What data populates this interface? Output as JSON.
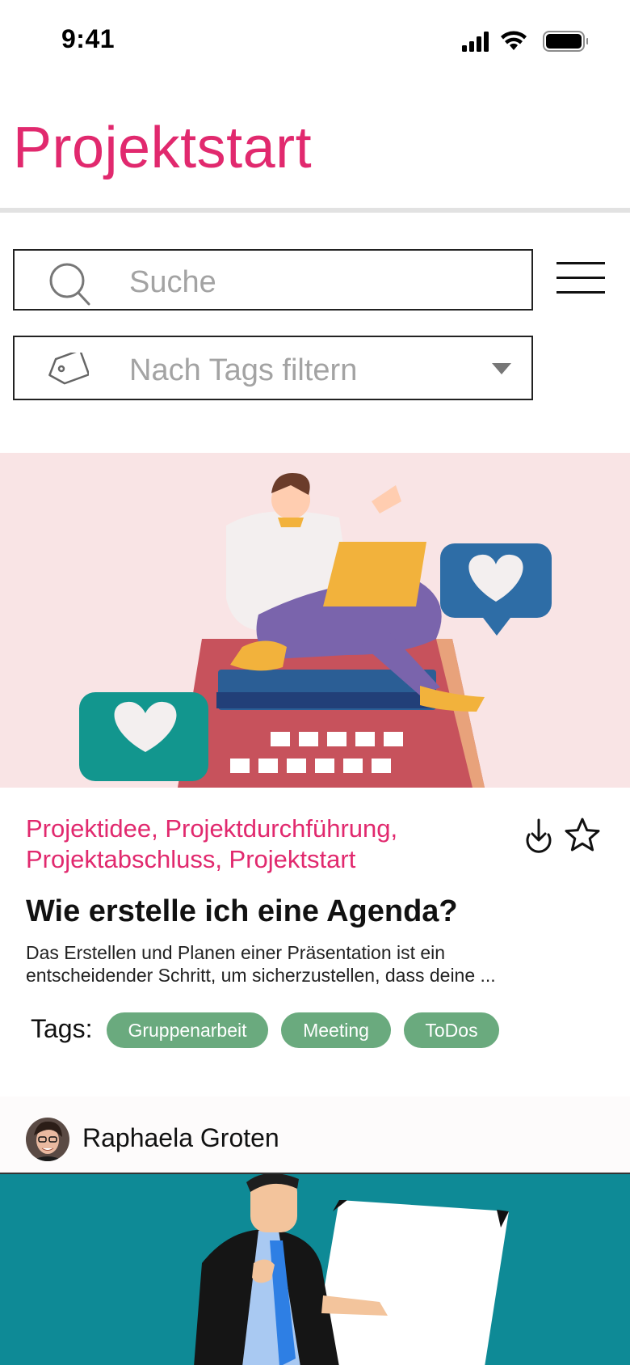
{
  "status_bar": {
    "time": "9:41"
  },
  "header": {
    "title": "Projektstart"
  },
  "search": {
    "placeholder": "Suche"
  },
  "filter": {
    "placeholder": "Nach Tags filtern"
  },
  "colors": {
    "accent": "#e1296e",
    "tag_pill": "#6aaa7e"
  },
  "icons": [
    "search-icon",
    "menu-icon",
    "tag-icon",
    "dropdown-arrow-icon",
    "download-icon",
    "star-icon"
  ],
  "card": {
    "category_lines": [
      "Projektidee, Projektdurchführung,",
      "Projektabschluss, Projektstart"
    ],
    "title": "Wie erstelle ich eine Agenda?",
    "excerpt_lines": [
      "Das Erstellen und Planen einer Präsentation ist ein",
      "entscheidender  Schritt, um sicherzustellen, dass deine ..."
    ],
    "tags_label": "Tags:",
    "tags": [
      "Gruppenarbeit",
      "Meeting",
      "ToDos"
    ]
  },
  "author": {
    "name": "Raphaela Groten"
  }
}
